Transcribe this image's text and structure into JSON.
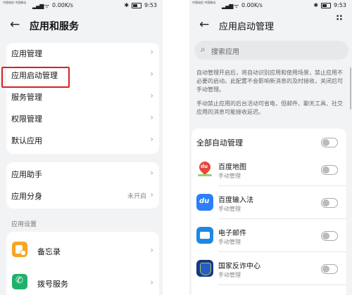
{
  "left": {
    "status": {
      "carrier": "中国电信 中国移动",
      "speed": "0.00K/s",
      "time": "9:53"
    },
    "title": "应用和服务",
    "menu_group1": [
      "应用管理",
      "应用启动管理",
      "服务管理",
      "权限管理",
      "默认应用"
    ],
    "menu_group2": [
      {
        "label": "应用助手",
        "value": ""
      },
      {
        "label": "应用分身",
        "value": "未开启"
      }
    ],
    "section_label": "应用设置",
    "apps": [
      {
        "label": "备忘录",
        "icon": "memo-icon",
        "color": "#f5a623"
      },
      {
        "label": "拨号服务",
        "icon": "phone-icon",
        "color": "#1fb16a"
      }
    ]
  },
  "right": {
    "status": {
      "carrier": "中国电信 中国移动",
      "speed": "0.00K/s",
      "time": "9:53"
    },
    "title": "应用启动管理",
    "search_placeholder": "搜索应用",
    "desc1": "自动管理开启后，将自动识别应用和使用场景，禁止应用不必要的启动。此配置不会影响新消息的及时接收，关闭后可手动管理。",
    "desc2": "手动禁止应用的后台活动可省电，但邮件、聊天工具、社交应用的消息可能接收延迟。",
    "all_label": "全部自动管理",
    "apps": [
      {
        "name": "百度地图",
        "mode": "手动管理",
        "icon": "baidu-map-icon"
      },
      {
        "name": "百度输入法",
        "mode": "手动管理",
        "icon": "baidu-input-icon"
      },
      {
        "name": "电子邮件",
        "mode": "手动管理",
        "icon": "email-icon"
      },
      {
        "name": "国家反诈中心",
        "mode": "手动管理",
        "icon": "anti-fraud-icon"
      }
    ]
  },
  "colors": {
    "highlight": "#d42222",
    "background": "#f1f3f5",
    "card": "#ffffff"
  }
}
